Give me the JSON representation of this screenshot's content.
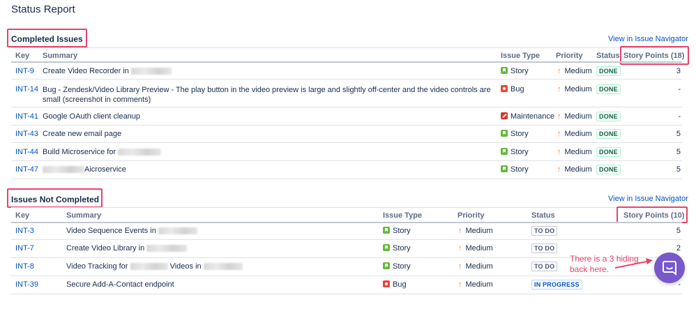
{
  "page_title": "Status Report",
  "completed": {
    "title": "Completed Issues",
    "navigator_link": "View in Issue Navigator",
    "headers": {
      "key": "Key",
      "summary": "Summary",
      "issue_type": "Issue Type",
      "priority": "Priority",
      "status": "Status",
      "story_points": "Story Points (18)"
    },
    "rows": [
      {
        "key": "INT-9",
        "summary": "Create Video Recorder in",
        "type": "Story",
        "priority": "Medium",
        "status": "DONE",
        "points": "3"
      },
      {
        "key": "INT-14",
        "summary": "Bug - Zendesk/Video Library Preview - The play button in the video preview is large and slightly off-center and the video controls are small (screenshot in comments)",
        "type": "Bug",
        "priority": "Medium",
        "status": "DONE",
        "points": "-"
      },
      {
        "key": "INT-41",
        "summary": "Google OAuth client cleanup",
        "type": "Maintenance",
        "priority": "Medium",
        "status": "DONE",
        "points": "-"
      },
      {
        "key": "INT-43",
        "summary": "Create new email page",
        "type": "Story",
        "priority": "Medium",
        "status": "DONE",
        "points": "5"
      },
      {
        "key": "INT-44",
        "summary": "Build Microservice for",
        "type": "Story",
        "priority": "Medium",
        "status": "DONE",
        "points": "5"
      },
      {
        "key": "INT-47",
        "summary": "Aicroservice",
        "type": "Story",
        "priority": "Medium",
        "status": "DONE",
        "points": "5"
      }
    ]
  },
  "not_completed": {
    "title": "Issues Not Completed",
    "navigator_link": "View in Issue Navigator",
    "headers": {
      "key": "Key",
      "summary": "Summary",
      "issue_type": "Issue Type",
      "priority": "Priority",
      "status": "Status",
      "story_points": "Story Points (10)"
    },
    "rows": [
      {
        "key": "INT-3",
        "summary_a": "Video Sequence Events in",
        "type": "Story",
        "priority": "Medium",
        "status": "TO DO",
        "points": "5"
      },
      {
        "key": "INT-7",
        "summary_a": "Create Video Library in",
        "type": "Story",
        "priority": "Medium",
        "status": "TO DO",
        "points": "2"
      },
      {
        "key": "INT-8",
        "summary_a": "Video Tracking for",
        "summary_b": "Videos in",
        "type": "Story",
        "priority": "Medium",
        "status": "TO DO",
        "points": ""
      },
      {
        "key": "INT-39",
        "summary_a": "Secure Add-A-Contact endpoint",
        "type": "Bug",
        "priority": "Medium",
        "status": "IN PROGRESS",
        "points": "-"
      }
    ]
  },
  "annotation": "There is a 3 hiding back here.",
  "colors": {
    "highlight": "#e8426b",
    "link": "#0052cc",
    "story": "#63ba3c",
    "bug": "#e5493a",
    "chat_bubble": "#7759c9"
  },
  "icons": {
    "story": "story-icon",
    "bug": "bug-icon",
    "maintenance": "maintenance-icon",
    "priority": "priority-medium-icon",
    "chat": "chat-icon"
  }
}
